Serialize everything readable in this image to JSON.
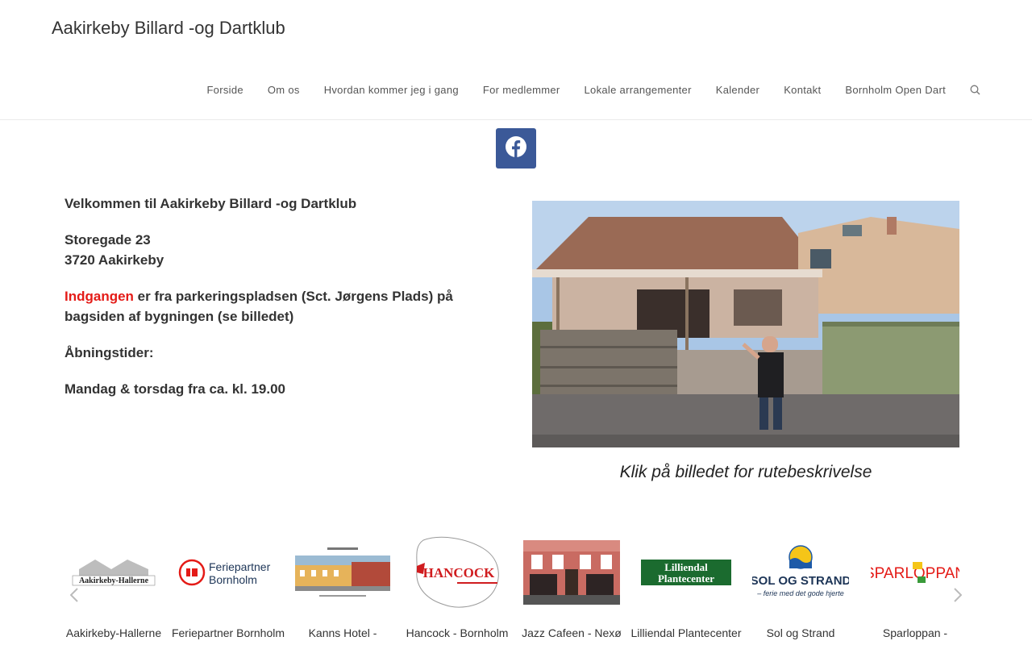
{
  "header": {
    "site_title": "Aakirkeby Billard -og Dartklub",
    "nav": [
      "Forside",
      "Om os",
      "Hvordan kommer jeg i gang",
      "For medlemmer",
      "Lokale arrangementer",
      "Kalender",
      "Kontakt",
      "Bornholm Open Dart"
    ],
    "search_icon": "search-icon"
  },
  "social": {
    "icon": "facebook-icon",
    "color": "#3b5998"
  },
  "intro": {
    "welcome": "Velkommen til Aakirkeby Billard -og Dartklub",
    "street": "Storegade 23",
    "city": "3720 Aakirkeby",
    "entrance_highlight": "Indgangen",
    "entrance_rest": " er fra parkeringspladsen (Sct. Jørgens Plads) på bagsiden af bygningen (se billedet)",
    "hours_label": "Åbningstider:",
    "hours": "Mandag & torsdag fra ca. kl. 19.00",
    "accent_color": "#e41b17"
  },
  "photo": {
    "caption": "Klik på billedet for rutebeskrivelse"
  },
  "sponsors": [
    {
      "name": "Aakirkeby-Hallerne",
      "logo_text": "Aakirkeby-Hallerne"
    },
    {
      "name": "Feriepartner Bornholm",
      "logo_text": "Feriepartner Bornholm"
    },
    {
      "name": "Kanns Hotel -",
      "logo_text": ""
    },
    {
      "name": "Hancock - Bornholm",
      "logo_text": "HANCOCK"
    },
    {
      "name": "Jazz Cafeen - Nexø",
      "logo_text": ""
    },
    {
      "name": "Lilliendal Plantecenter",
      "logo_text": "Lilliendal Plantecenter"
    },
    {
      "name": "Sol og Strand",
      "logo_text": "SOL OG STRAND",
      "logo_tagline": "– ferie med det gode hjerte"
    },
    {
      "name": "Sparloppan -",
      "logo_text": "SPARLOPPAN"
    }
  ]
}
